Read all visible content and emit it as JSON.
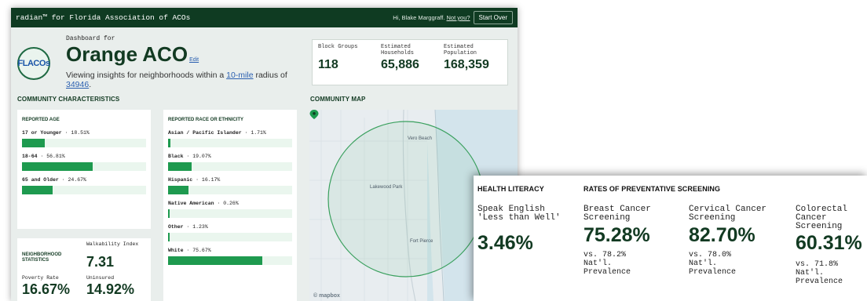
{
  "topbar": {
    "brand": "radian™ for Florida Association of ACOs",
    "greeting": "Hi, Blake Marggraff.",
    "not_you": "Not you?",
    "start_over": "Start Over"
  },
  "header": {
    "logo_text": "FLACOs",
    "dashboard_for": "Dashboard for",
    "org_name": "Orange ACO",
    "edit": "Edit",
    "viewing_prefix": "Viewing insights for neighborhoods within a",
    "radius": "10-mile",
    "viewing_mid": "radius of",
    "zip": "34946",
    "viewing_suffix": "."
  },
  "summary": {
    "block_groups_label": "Block Groups",
    "block_groups": "118",
    "households_label": "Estimated Households",
    "households": "65,886",
    "population_label": "Estimated Population",
    "population": "168,359"
  },
  "community": {
    "title": "COMMUNITY CHARACTERISTICS",
    "age": {
      "title": "REPORTED AGE",
      "rows": [
        {
          "label": "17 or Younger",
          "value": "18.51%",
          "fraction": 0.1851
        },
        {
          "label": "18-64",
          "value": "56.81%",
          "fraction": 0.5681
        },
        {
          "label": "65 and Older",
          "value": "24.67%",
          "fraction": 0.2467
        }
      ]
    },
    "race": {
      "title": "REPORTED RACE OR ETHNICITY",
      "rows": [
        {
          "label": "Asian / Pacific Islander",
          "value": "1.71%",
          "fraction": 0.0171
        },
        {
          "label": "Black",
          "value": "19.07%",
          "fraction": 0.1907
        },
        {
          "label": "Hispanic",
          "value": "16.17%",
          "fraction": 0.1617
        },
        {
          "label": "Native American",
          "value": "0.26%",
          "fraction": 0.0026
        },
        {
          "label": "Other",
          "value": "1.23%",
          "fraction": 0.0123
        },
        {
          "label": "White",
          "value": "75.67%",
          "fraction": 0.7567
        }
      ]
    },
    "neighborhood": {
      "title": "NEIGHBORHOOD STATISTICS",
      "walkability_label": "Walkability Index",
      "walkability": "7.31",
      "poverty_label": "Poverty Rate",
      "poverty": "16.67%",
      "uninsured_label": "Uninsured",
      "uninsured": "14.92%"
    }
  },
  "map": {
    "title": "COMMUNITY MAP",
    "labels": {
      "vero": "Vero Beach",
      "lakewood": "Lakewood Park",
      "fortpierce": "Fort Pierce"
    },
    "attribution": "© mapbox"
  },
  "overlay": {
    "health_literacy": {
      "title": "HEALTH LITERACY",
      "label": "Speak English 'Less than Well'",
      "value": "3.46%"
    },
    "screening_title": "RATES OF PREVENTATIVE SCREENING",
    "screenings": [
      {
        "label": "Breast Cancer Screening",
        "value": "75.28%",
        "note": "vs. 78.2% Nat'l. Prevalence"
      },
      {
        "label": "Cervical Cancer Screening",
        "value": "82.70%",
        "note": "vs. 78.0% Nat'l. Prevalence"
      },
      {
        "label": "Colorectal Cancer Screening",
        "value": "60.31%",
        "note": "vs. 71.8% Nat'l. Prevalence"
      }
    ]
  },
  "colors": {
    "accent": "#1e9a4f",
    "dark_green": "#123a22",
    "topbar": "#0f3b22",
    "bar_track": "#eaf6ee"
  }
}
